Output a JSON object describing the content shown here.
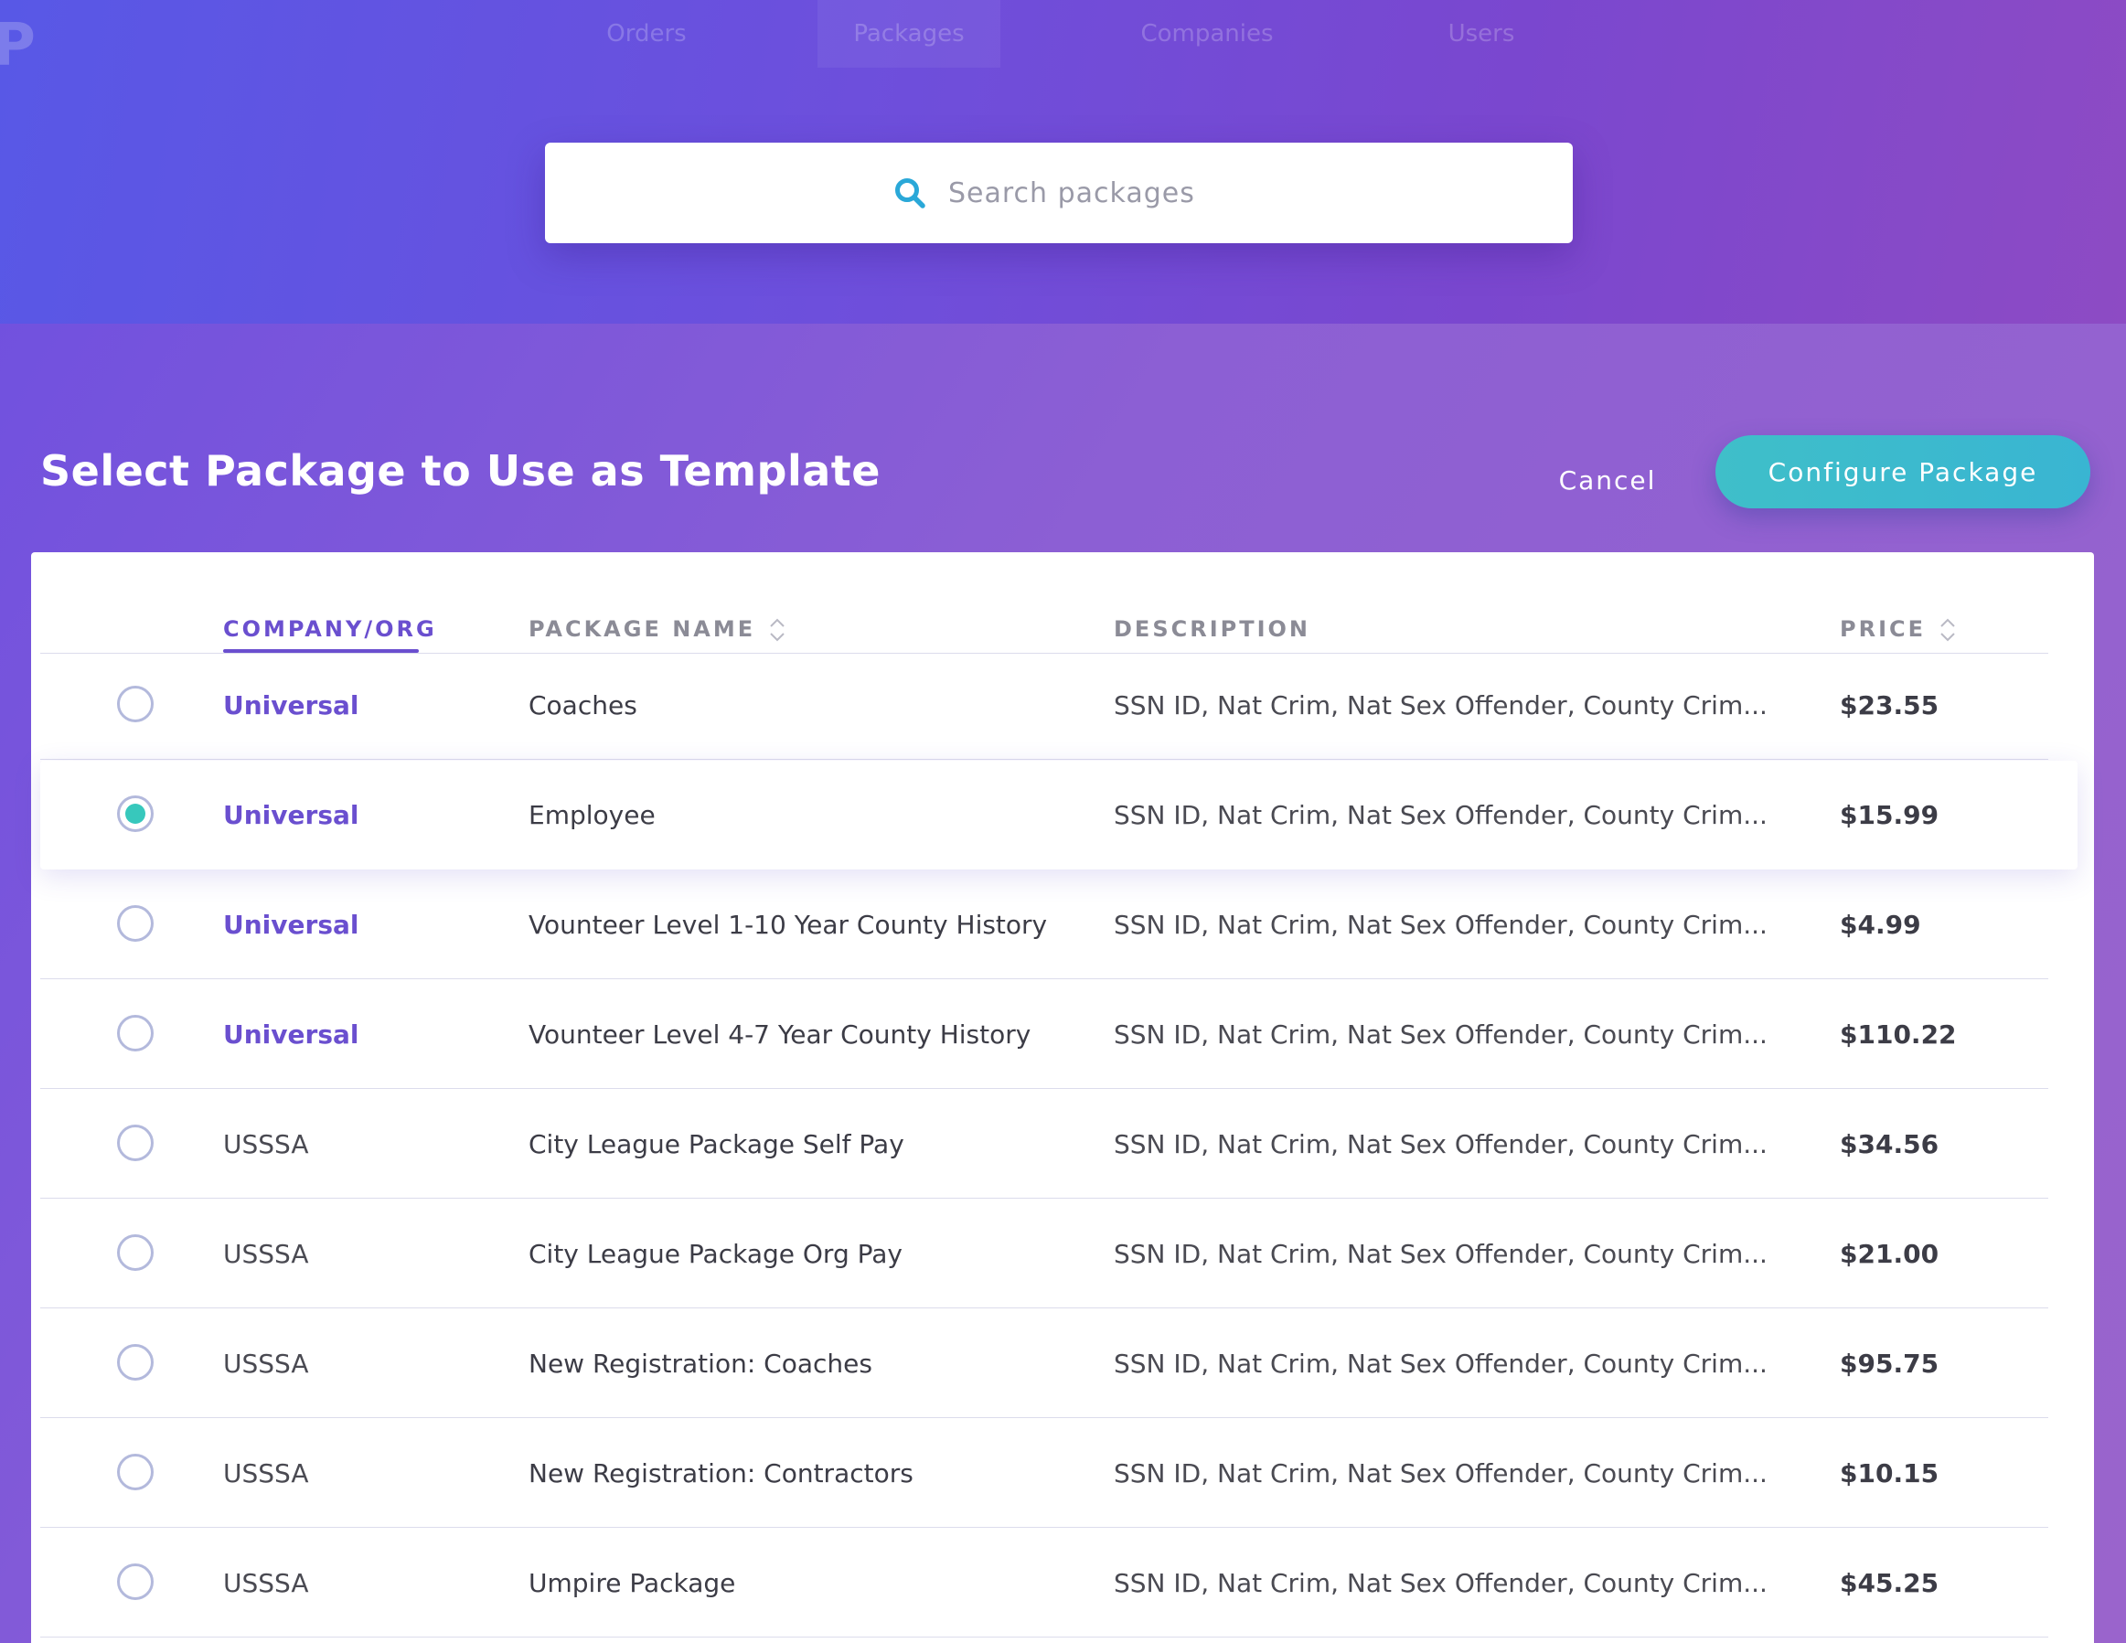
{
  "nav": {
    "logo_fragment": "P",
    "items": [
      {
        "label": "Orders",
        "active": false
      },
      {
        "label": "Packages",
        "active": true
      },
      {
        "label": "Companies",
        "active": false
      },
      {
        "label": "Users",
        "active": false
      }
    ]
  },
  "search": {
    "placeholder": "Search packages",
    "value": "",
    "icon": "search-icon"
  },
  "header": {
    "title": "Select Package to Use as Template",
    "cancel_label": "Cancel",
    "configure_label": "Configure Package"
  },
  "table": {
    "columns": [
      {
        "label": "COMPANY/ORG",
        "active": true,
        "sortable": false
      },
      {
        "label": "PACKAGE NAME",
        "active": false,
        "sortable": true
      },
      {
        "label": "DESCRIPTION",
        "active": false,
        "sortable": false
      },
      {
        "label": "PRICE",
        "active": false,
        "sortable": true
      }
    ],
    "rows": [
      {
        "company": "Universal",
        "name": "Coaches",
        "description": "SSN ID, Nat Crim, Nat Sex Offender, County Crim...",
        "price": "$23.55",
        "selected": false
      },
      {
        "company": "Universal",
        "name": "Employee",
        "description": "SSN ID, Nat Crim, Nat Sex Offender, County Crim...",
        "price": "$15.99",
        "selected": true
      },
      {
        "company": "Universal",
        "name": "Vounteer Level 1-10 Year County History",
        "description": "SSN ID, Nat Crim, Nat Sex Offender, County Crim...",
        "price": "$4.99",
        "selected": false
      },
      {
        "company": "Universal",
        "name": "Vounteer Level 4-7 Year County History",
        "description": "SSN ID, Nat Crim, Nat Sex Offender, County Crim...",
        "price": "$110.22",
        "selected": false
      },
      {
        "company": "USSSA",
        "name": "City League Package Self Pay",
        "description": "SSN ID, Nat Crim, Nat Sex Offender, County Crim...",
        "price": "$34.56",
        "selected": false
      },
      {
        "company": "USSSA",
        "name": "City League Package Org Pay",
        "description": "SSN ID, Nat Crim, Nat Sex Offender, County Crim...",
        "price": "$21.00",
        "selected": false
      },
      {
        "company": "USSSA",
        "name": "New Registration: Coaches",
        "description": "SSN ID, Nat Crim, Nat Sex Offender, County Crim...",
        "price": "$95.75",
        "selected": false
      },
      {
        "company": "USSSA",
        "name": "New Registration: Contractors",
        "description": "SSN ID, Nat Crim, Nat Sex Offender, County Crim...",
        "price": "$10.15",
        "selected": false
      },
      {
        "company": "USSSA",
        "name": "Umpire Package",
        "description": "SSN ID, Nat Crim, Nat Sex Offender, County Crim...",
        "price": "$45.25",
        "selected": false
      }
    ]
  },
  "colors": {
    "accent_purple": "#6a4fcf",
    "accent_teal": "#37c8bc",
    "button_teal": "#3fbfc9"
  }
}
